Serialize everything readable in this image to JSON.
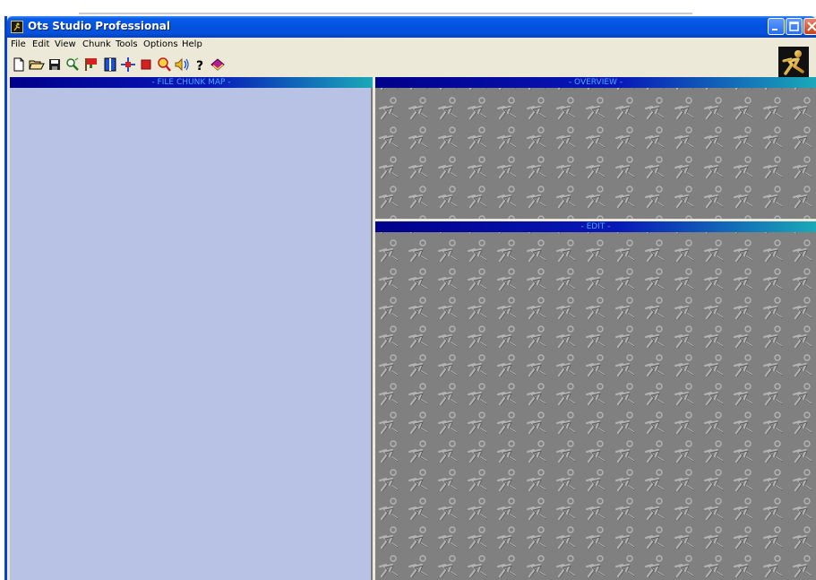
{
  "window": {
    "title": "Ots Studio Professional"
  },
  "caption_buttons": {
    "minimize": "_",
    "maximize": "□",
    "close": "✕"
  },
  "menu": [
    "File",
    "Edit",
    "View",
    "Chunk",
    "Tools",
    "Options",
    "Help"
  ],
  "toolbar": {
    "buttons": [
      "new-file-icon",
      "open-folder-icon",
      "save-icon",
      "search-icon",
      "flag-icon",
      "split-icon",
      "move-icon",
      "stop-icon",
      "zoom-icon",
      "volume-icon",
      "help-icon",
      "book-icon"
    ]
  },
  "panels": {
    "file_chunk_map": "- FILE CHUNK MAP -",
    "overview": "- OVERVIEW -",
    "edit": "- EDIT -"
  },
  "colors": {
    "titlebar": "#0453e2",
    "chunk_map_bg": "#b8c2e4",
    "tile_bg": "#808080",
    "header_start": "#00008a",
    "header_end": "#1aa9b8"
  }
}
